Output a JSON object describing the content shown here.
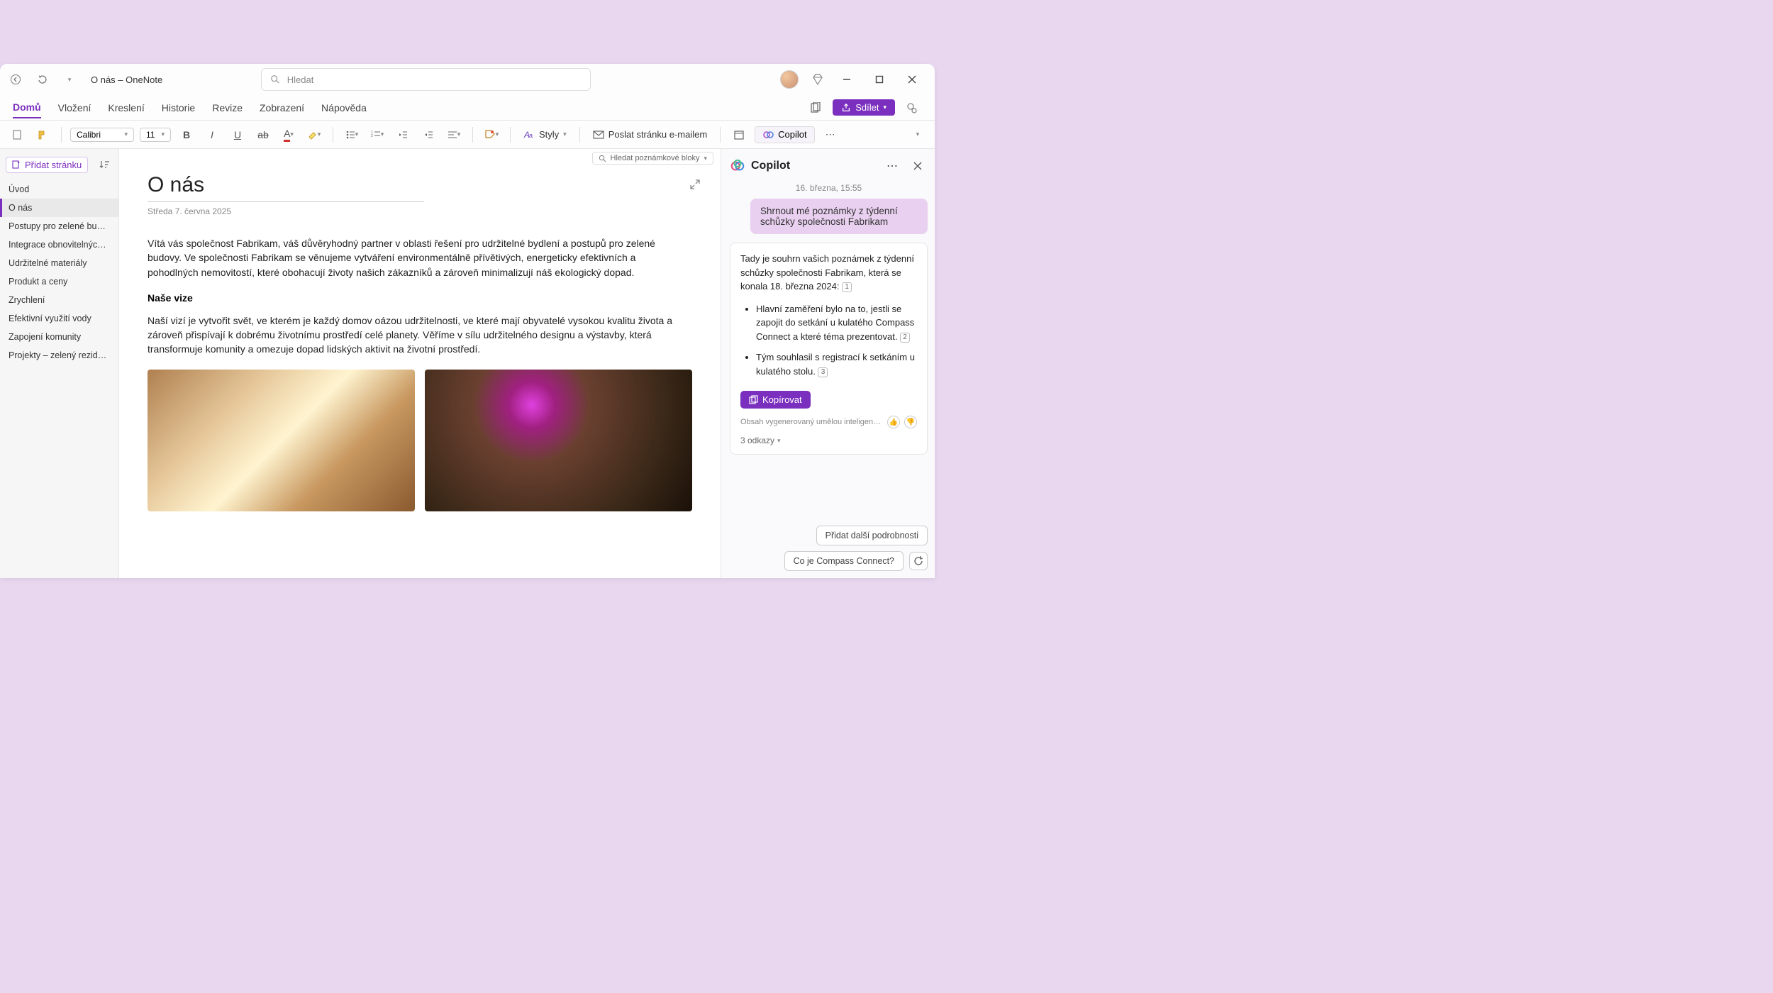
{
  "window_title": "O nás – OneNote",
  "search_placeholder": "Hledat",
  "tabs": {
    "home": "Domů",
    "insert": "Vložení",
    "draw": "Kreslení",
    "history": "Historie",
    "review": "Revize",
    "view": "Zobrazení",
    "help": "Nápověda"
  },
  "share_label": "Sdílet",
  "ribbon": {
    "font_name": "Calibri",
    "font_size": "11",
    "styles_label": "Styly",
    "email_label": "Poslat stránku e-mailem",
    "copilot_label": "Copilot"
  },
  "notebook_search": "Hledat poznámkové bloky",
  "sidebar": {
    "add_page": "Přidat stránku",
    "pages": [
      "Úvod",
      "O nás",
      "Postupy pro zelené budovy",
      "Integrace obnovitelných…",
      "Udržitelné materiály",
      "Produkt a ceny",
      "Zrychlení",
      "Efektivní využití vody",
      "Zapojení komunity",
      "Projekty – zelený reziden…"
    ],
    "selected_index": 1
  },
  "page": {
    "title": "O nás",
    "date": "Středa 7. června 2025",
    "intro": "Vítá vás společnost Fabrikam, váš důvěryhodný partner v oblasti řešení pro udržitelné bydlení a postupů pro zelené budovy. Ve společnosti Fabrikam se věnujeme vytváření environmentálně přívětivých, energeticky efektivních a pohodlných nemovitostí, které obohacují životy našich zákazníků a zároveň minimalizují náš ekologický dopad.",
    "sub1_title": "Naše vize",
    "sub1_body": "Naší vizí je vytvořit svět, ve kterém je každý domov oázou udržitelnosti, ve které mají obyvatelé vysokou kvalitu života a zároveň přispívají k dobrému životnímu prostředí celé planety. Věříme v sílu udržitelného designu a výstavby, která transformuje komunity a omezuje dopad lidských aktivit na životní prostředí."
  },
  "copilot": {
    "pane_title": "Copilot",
    "timestamp": "16. března, 15:55",
    "user_prompt": "Shrnout mé poznámky z týdenní schůzky společnosti Fabrikam",
    "summary_lead": "Tady je souhrn vašich poznámek z týdenní schůzky společnosti Fabrikam, která se konala 18. března 2024:",
    "cite1": "1",
    "bullet1": "Hlavní zaměření bylo na to, jestli se zapojit do setkání u kulatého Compass Connect a které téma prezentovat.",
    "cite2": "2",
    "bullet2": "Tým souhlasil s registrací k setkáním u kulatého stolu.",
    "cite3": "3",
    "copy_label": "Kopírovat",
    "ai_disclaimer": "Obsah vygenerovaný umělou inteligencí mů…",
    "refs_label": "3 odkazy",
    "suggestion1": "Přidat další podrobnosti",
    "suggestion2": "Co je Compass Connect?"
  }
}
